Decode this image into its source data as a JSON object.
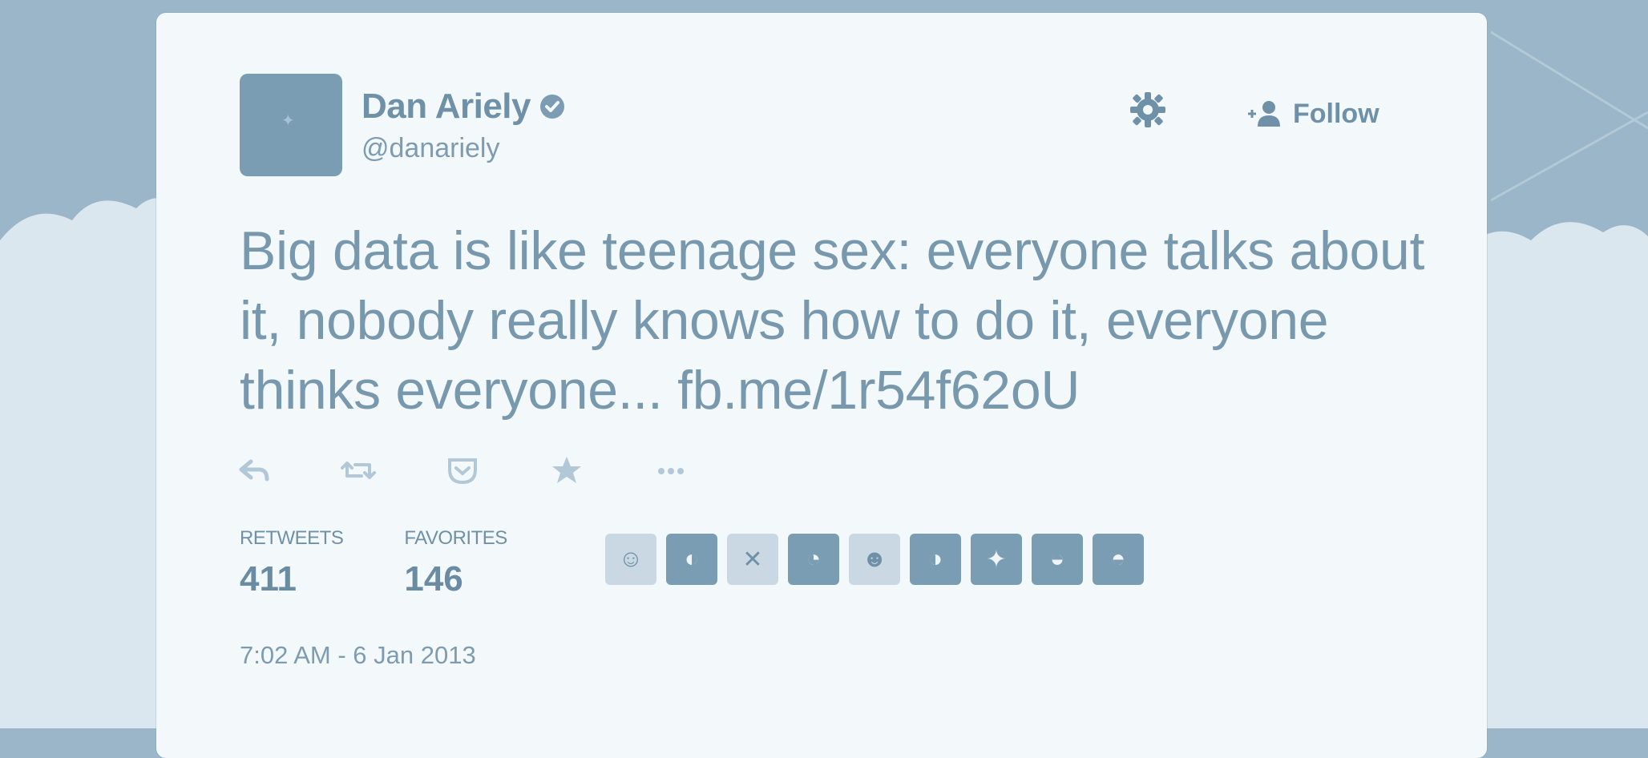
{
  "tweet_card": {
    "author": {
      "name": "Dan Ariely",
      "handle": "@danariely",
      "verified": true
    },
    "follow_label": "Follow",
    "text": "Big data is like teenage sex: everyone talks about it, nobody really knows how to do it, everyone thinks everyone...",
    "link": "fb.me/1r54f62oU",
    "actions": [
      "reply-icon",
      "retweet-icon",
      "pocket-icon",
      "favorite-icon",
      "more-icon"
    ],
    "stats": {
      "retweets_label": "RETWEETS",
      "retweets_value": "411",
      "favorites_label": "FAVORITES",
      "favorites_value": "146"
    },
    "timestamp": "7:02 AM - 6 Jan 2013"
  },
  "colors": {
    "background": "#9ab6c8",
    "card": "#f3f8fb",
    "text": "#7898ad",
    "accent": "#6f91a8"
  }
}
